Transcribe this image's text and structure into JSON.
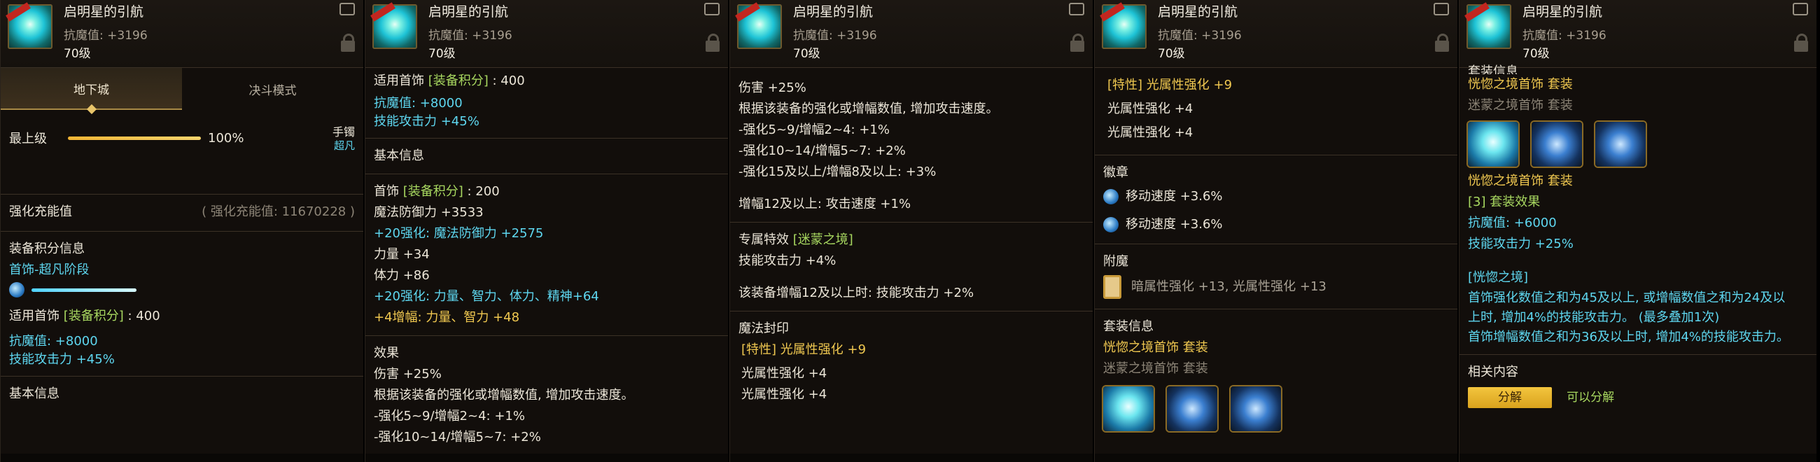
{
  "item": {
    "title": "启明星的引航",
    "stat": "抗魔值: +3196",
    "level": "70级"
  },
  "panel1": {
    "tabs": [
      "地下城",
      "决斗模式"
    ],
    "bar_label": "最上级",
    "bar_value": "100%",
    "slot_type": "手镯",
    "slot_grade": "超凡",
    "charge_label": "强化充能值",
    "charge_value": "( 强化充能值: 11670228 )",
    "equip_score_title": "装备积分信息",
    "equip_score_stage": "首饰-超凡阶段",
    "applicable_prefix": "适用首饰",
    "applicable_bracket": "[装备积分]",
    "applicable_value": ": 400",
    "anti_magic": "抗魔值: +8000",
    "skill_attack": "技能攻击力 +45%",
    "basic_info": "基本信息"
  },
  "panel2": {
    "applicable_prefix": "适用首饰",
    "applicable_bracket": "[装备积分]",
    "applicable_value": ": 400",
    "anti_magic": "抗魔值: +8000",
    "skill_attack": "技能攻击力 +45%",
    "basic_info": "基本信息",
    "jewel_prefix": "首饰",
    "jewel_bracket": "[装备积分]",
    "jewel_value": ": 200",
    "magic_def": "魔法防御力 +3533",
    "plus20_mdef": "+20强化: 魔法防御力 +2575",
    "str": "力量 +34",
    "vit": "体力 +86",
    "plus20_stats": "+20强化: 力量、智力、体力、精神+64",
    "amp4_prefix": "+4增幅: ",
    "amp4_value": "力量、智力 +48",
    "effect_title": "效果",
    "dmg": "伤害 +25%",
    "desc": "根据该装备的强化或增幅数值, 增加攻击速度。",
    "tier1": "-强化5~9/增幅2~4: +1%",
    "tier2_partial": "-强化10~14/增幅5~7: +2%"
  },
  "panel3": {
    "dmg": "伤害 +25%",
    "desc": "根据该装备的强化或增幅数值, 增加攻击速度。",
    "tier1": "-强化5~9/增幅2~4: +1%",
    "tier2": "-强化10~14/增幅5~7: +2%",
    "tier3": "-强化15及以上/增幅8及以上: +3%",
    "amp12": "增幅12及以上: 攻击速度 +1%",
    "exclusive_prefix": "专属特效 ",
    "exclusive_name": "[迷蒙之境]",
    "skill4": "技能攻击力 +4%",
    "amp12_skill": "该装备增幅12及以上时: 技能攻击力 +2%",
    "seal_title": "魔法封印",
    "trait": "[特性] 光属性强化 +9",
    "light1": "光属性强化 +4",
    "light2": "光属性强化 +4"
  },
  "panel4": {
    "trait": "[特性] 光属性强化 +9",
    "light1": "光属性强化 +4",
    "light2": "光属性强化 +4",
    "emblem_title": "徽章",
    "emblem1": "移动速度 +3.6%",
    "emblem2": "移动速度 +3.6%",
    "enchant_title": "附魔",
    "enchant_value": "暗属性强化 +13, 光属性强化 +13",
    "set_title": "套装信息",
    "set1_name": "恍惚之境首饰",
    "set1_tag": "套装",
    "set2_name": "迷蒙之境首饰",
    "set2_tag": "套装"
  },
  "panel5": {
    "set_title_partial": "套装信息",
    "set1_name": "恍惚之境首饰",
    "set1_tag": "套装",
    "set2_name": "迷蒙之境首饰",
    "set2_tag": "套装",
    "set3_name": "恍惚之境首饰",
    "set3_tag": "套装",
    "set_effect": "[3] 套装效果",
    "anti_magic": "抗魔值: +6000",
    "skill": "技能攻击力 +25%",
    "realm_title": "[恍惚之境]",
    "realm_desc1": "首饰强化数值之和为45及以上, 或增幅数值之和为24及以",
    "realm_desc2": "上时, 增加4%的技能攻击力。 (最多叠加1次)",
    "realm_desc3": "首饰增幅数值之和为36及以上时, 增加4%的技能攻击力。",
    "related_title": "相关内容",
    "disassemble_button": "分解",
    "disassemble_note": "可以分解"
  }
}
